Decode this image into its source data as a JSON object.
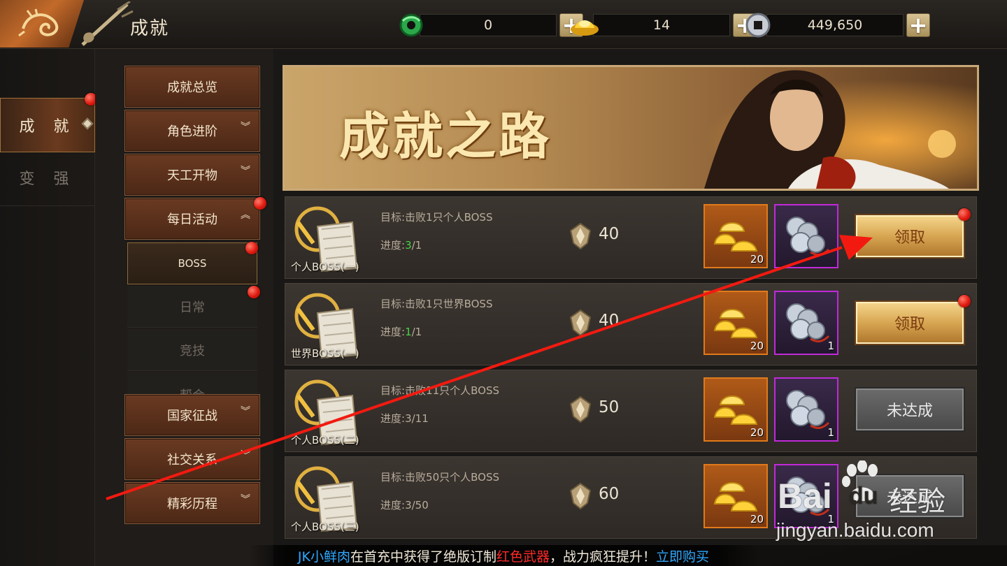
{
  "header": {
    "title": "成就",
    "currencies": [
      {
        "icon": "jade-icon",
        "value": "0"
      },
      {
        "icon": "gold-ingot-icon",
        "value": "14"
      },
      {
        "icon": "silver-coin-icon",
        "value": "449,650"
      }
    ]
  },
  "left_tabs": [
    {
      "label": "成 就",
      "active": true,
      "badge": true
    },
    {
      "label": "变 强",
      "active": false,
      "badge": false
    }
  ],
  "categories": {
    "overview": "成就总览",
    "role": "角色进阶",
    "craft": "天工开物",
    "daily": "每日活动",
    "daily_subs": [
      "BOSS",
      "日常",
      "竞技",
      "帮会"
    ],
    "nation": "国家征战",
    "social": "社交关系",
    "history": "精彩历程"
  },
  "banner": {
    "title": "成就之路"
  },
  "achievements": [
    {
      "name": "个人BOSS(一)",
      "goal": "目标:击败1只个人BOSS",
      "progress_label": "进度:",
      "progress_current": "3",
      "progress_total": "/1",
      "points": "40",
      "gold_count": "20",
      "coin_count": "",
      "button": "领取",
      "claimable": true
    },
    {
      "name": "世界BOSS(一)",
      "goal": "目标:击败1只世界BOSS",
      "progress_label": "进度:",
      "progress_current": "1",
      "progress_total": "/1",
      "points": "40",
      "gold_count": "20",
      "coin_count": "1",
      "button": "领取",
      "claimable": true
    },
    {
      "name": "个人BOSS(二)",
      "goal": "目标:击败11只个人BOSS",
      "progress_label": "进度:",
      "progress_current": "3",
      "progress_total": "/11",
      "points": "50",
      "gold_count": "20",
      "coin_count": "1",
      "button": "未达成",
      "claimable": false
    },
    {
      "name": "个人BOSS(三)",
      "goal": "目标:击败50只个人BOSS",
      "progress_label": "进度:",
      "progress_current": "3",
      "progress_total": "/50",
      "points": "60",
      "gold_count": "20",
      "coin_count": "1",
      "button": "未达成",
      "claimable": false
    }
  ],
  "ticker": {
    "name": "JK小鲜肉",
    "text1": "在首充中获得了绝版订制",
    "highlight": "红色武器",
    "text2": "，战力疯狂提升！",
    "link": "立即购买"
  },
  "watermark": {
    "brand": "Bai",
    "brand2": "du",
    "cn": "经验",
    "url": "jingyan.baidu.com"
  },
  "colors": {
    "accent_gold": "#d7a652",
    "badge_red": "#e01a10",
    "progress_green": "#45d445",
    "ticker_blue": "#2fa8ff",
    "ticker_red": "#ff2a2a"
  }
}
